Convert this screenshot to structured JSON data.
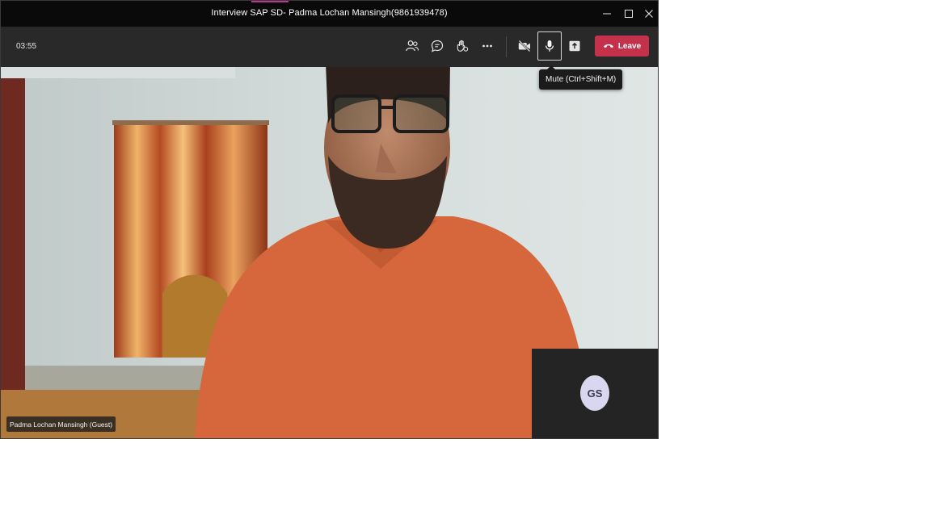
{
  "window": {
    "title": "Interview SAP SD- Padma Lochan Mansingh(9861939478)"
  },
  "controls": {
    "timer": "03:55",
    "leave_label": "Leave",
    "mic_tooltip": "Mute (Ctrl+Shift+M)",
    "buttons": [
      {
        "icon": "participants-icon"
      },
      {
        "icon": "chat-icon"
      },
      {
        "icon": "raise-hand-icon"
      },
      {
        "icon": "more-options-icon"
      },
      {
        "icon": "camera-off-icon"
      },
      {
        "icon": "microphone-icon",
        "active": true
      },
      {
        "icon": "share-screen-icon"
      }
    ]
  },
  "video": {
    "participant_name": "Padma Lochan Mansingh (Guest)",
    "self_initials": "GS"
  },
  "colors": {
    "leave_button": "#c4314b",
    "titlebar": "#0a0a0a",
    "toolbar": "#292929",
    "avatar_bg": "#d9d7f0"
  }
}
